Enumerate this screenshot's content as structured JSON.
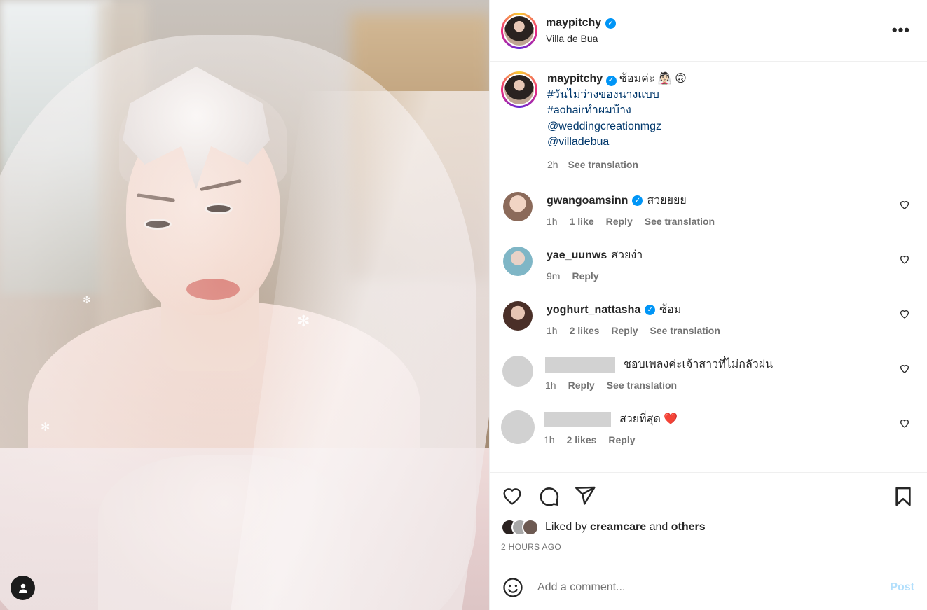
{
  "header": {
    "username": "maypitchy",
    "location": "Villa de Bua",
    "more_label": "•••"
  },
  "caption": {
    "username": "maypitchy",
    "text": "ซ้อมค่ะ 👰🏻 🙃",
    "tags": [
      "#วันไม่ว่างของนางแบบ",
      "#aohairทำผมบ้าง",
      "@weddingcreationmgz",
      "@villadebua"
    ],
    "time": "2h",
    "see_translation": "See translation"
  },
  "comments": [
    {
      "username": "gwangoamsinn",
      "verified": true,
      "text": "สวยยยย",
      "time": "1h",
      "likes": "1 like",
      "reply": "Reply",
      "translation": "See translation",
      "avatar_color": "#d7b8a8"
    },
    {
      "username": "yae_uunws",
      "verified": false,
      "text": "สวยง่า",
      "time": "9m",
      "likes": "",
      "reply": "Reply",
      "translation": "",
      "avatar_color": "#a9c9d4"
    },
    {
      "username": "yoghurt_nattasha",
      "verified": true,
      "text": "ซ้อม",
      "time": "1h",
      "likes": "2 likes",
      "reply": "Reply",
      "translation": "See translation",
      "avatar_color": "#8a5a4c"
    },
    {
      "username": "",
      "verified": false,
      "text": "ชอบเพลงค่ะเจ้าสาวที่ไม่กลัวฝน",
      "time": "1h",
      "likes": "",
      "reply": "Reply",
      "translation": "See translation",
      "avatar_color": "#d1d1d1"
    },
    {
      "username": "",
      "verified": false,
      "text": "สวยที่สุด ❤️",
      "time": "1h",
      "likes": "2 likes",
      "reply": "Reply",
      "translation": "",
      "avatar_color": "#d1d1d1"
    }
  ],
  "likes": {
    "prefix": "Liked by",
    "user": "creamcare",
    "and": "and",
    "others": "others",
    "time_ago": "2 HOURS AGO"
  },
  "add_comment": {
    "placeholder": "Add a comment...",
    "post_label": "Post"
  },
  "colors": {
    "verified": "#0095f6",
    "link": "#00376b",
    "muted": "#737373",
    "post_disabled": "#b2dffc"
  }
}
